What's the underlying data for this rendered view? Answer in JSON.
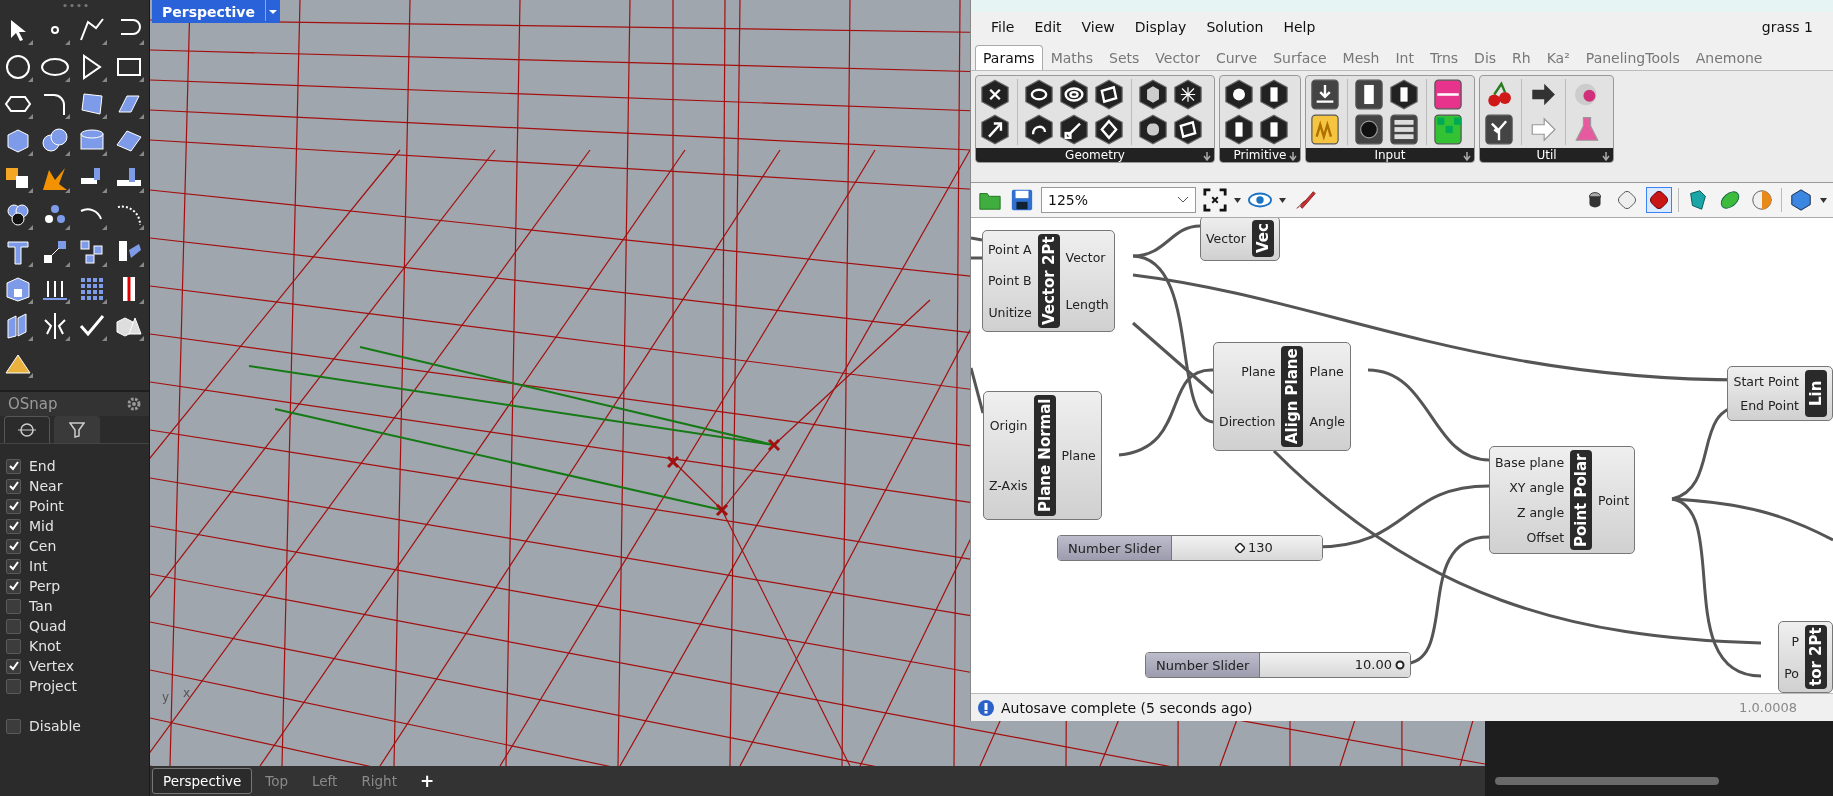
{
  "left_panel": {
    "osnap": {
      "title": "OSnap",
      "tabs": [
        {
          "kind": "snap",
          "selected": true
        },
        {
          "kind": "filter",
          "selected": false
        }
      ],
      "options": [
        {
          "label": "End",
          "checked": true
        },
        {
          "label": "Near",
          "checked": true
        },
        {
          "label": "Point",
          "checked": true
        },
        {
          "label": "Mid",
          "checked": true
        },
        {
          "label": "Cen",
          "checked": true
        },
        {
          "label": "Int",
          "checked": true
        },
        {
          "label": "Perp",
          "checked": true
        },
        {
          "label": "Tan",
          "checked": false
        },
        {
          "label": "Quad",
          "checked": false
        },
        {
          "label": "Knot",
          "checked": false
        },
        {
          "label": "Vertex",
          "checked": true
        },
        {
          "label": "Project",
          "checked": false
        }
      ],
      "disable": {
        "label": "Disable",
        "checked": false
      }
    }
  },
  "viewport": {
    "title": "Perspective",
    "axis_labels": [
      "y",
      "x"
    ]
  },
  "viewport_tabs": [
    {
      "label": "Perspective",
      "selected": true
    },
    {
      "label": "Top",
      "selected": false
    },
    {
      "label": "Left",
      "selected": false
    },
    {
      "label": "Right",
      "selected": false
    }
  ],
  "add_tab": "+",
  "grasshopper": {
    "menu": [
      "File",
      "Edit",
      "View",
      "Display",
      "Solution",
      "Help"
    ],
    "document_title": "grass 1",
    "tabs": [
      {
        "label": "Params",
        "selected": true
      },
      {
        "label": "Maths",
        "selected": false
      },
      {
        "label": "Sets",
        "selected": false
      },
      {
        "label": "Vector",
        "selected": false
      },
      {
        "label": "Curve",
        "selected": false
      },
      {
        "label": "Surface",
        "selected": false
      },
      {
        "label": "Mesh",
        "selected": false
      },
      {
        "label": "Int",
        "selected": false
      },
      {
        "label": "Trns",
        "selected": false
      },
      {
        "label": "Dis",
        "selected": false
      },
      {
        "label": "Rh",
        "selected": false
      },
      {
        "label": "Ka²",
        "selected": false
      },
      {
        "label": "PanelingTools",
        "selected": false
      },
      {
        "label": "Anemone",
        "selected": false
      }
    ],
    "ribbon_groups": [
      {
        "kind": "geometry",
        "label": "Geometry"
      },
      {
        "kind": "primitive",
        "label": "Primitive"
      },
      {
        "kind": "input",
        "label": "Input"
      },
      {
        "kind": "util",
        "label": "Util"
      }
    ],
    "zoom": "125%",
    "preview_modes": [
      {
        "kind": "wireframe",
        "selected": false
      },
      {
        "kind": "ghost",
        "selected": false
      },
      {
        "kind": "shaded",
        "selected": true
      }
    ],
    "nodes": [
      {
        "title": "Vector 2Pt",
        "inputs": [
          "Point A",
          "Point B",
          "Unitize"
        ],
        "outputs": [
          "Vector",
          "Length"
        ]
      },
      {
        "title": "Vec",
        "inputs": [
          "Vector"
        ]
      },
      {
        "title": "Plane Normal",
        "inputs": [
          "Origin",
          "Z-Axis"
        ],
        "outputs": [
          "Plane"
        ]
      },
      {
        "title": "Align Plane",
        "inputs": [
          "Plane",
          "Direction"
        ],
        "outputs": [
          "Plane",
          "Angle"
        ]
      },
      {
        "title": "Point Polar",
        "inputs": [
          "Base plane",
          "XY angle",
          "Z angle",
          "Offset"
        ],
        "outputs": [
          "Point"
        ]
      },
      {
        "title": "Lin",
        "inputs": [
          "Start Point",
          "End Point"
        ]
      },
      {
        "title": "tor 2Pt",
        "inputs": [
          "P",
          "Po"
        ]
      }
    ],
    "sliders": [
      {
        "label": "Number Slider",
        "value": "130",
        "kind": "integer",
        "level": 0.45
      },
      {
        "label": "Number Slider",
        "value": "10.00",
        "kind": "decimal",
        "level": 0.93
      }
    ],
    "status": "Autosave complete (5 seconds ago)",
    "version": "1.0.0008"
  }
}
